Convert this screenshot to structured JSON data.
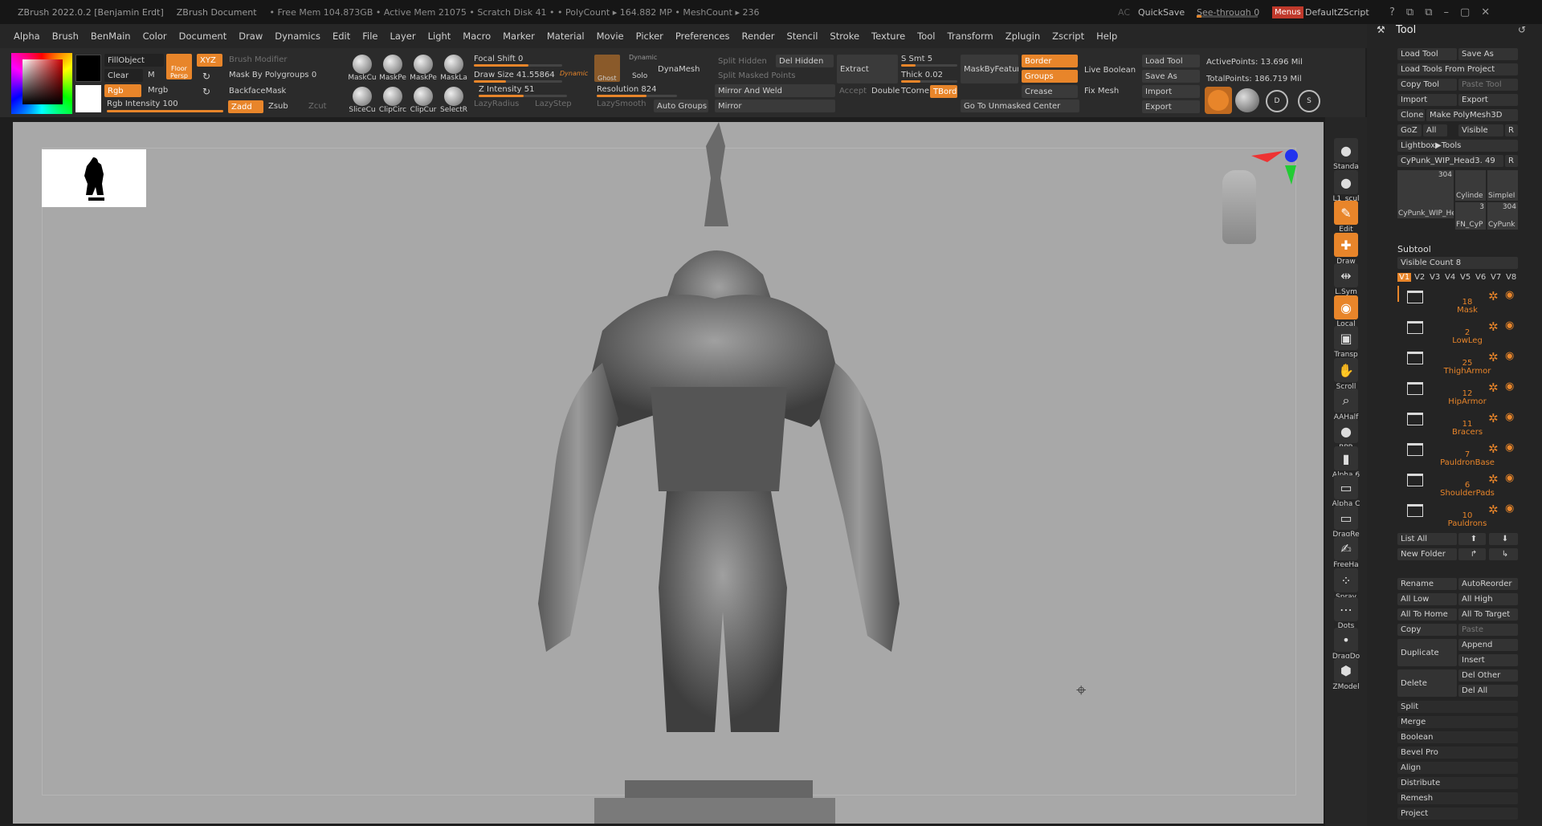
{
  "titlebar": {
    "app": "ZBrush 2022.0.2 [Benjamin Erdt]",
    "doc": "ZBrush Document",
    "stats": "• Free Mem 104.873GB • Active Mem 21075 • Scratch Disk 41 • • PolyCount ▸ 164.882 MP • MeshCount ▸ 236",
    "ac": "AC",
    "quicksave": "QuickSave",
    "seethrough": "See-through  0",
    "menus": "Menus",
    "script": "DefaultZScript"
  },
  "menu": [
    "Alpha",
    "Brush",
    "BenMain",
    "Color",
    "Document",
    "Draw",
    "Dynamics",
    "Edit",
    "File",
    "Layer",
    "Light",
    "Macro",
    "Marker",
    "Material",
    "Movie",
    "Picker",
    "Preferences",
    "Render",
    "Stencil",
    "Stroke",
    "Texture",
    "Tool",
    "Transform",
    "Zplugin",
    "Zscript",
    "Help"
  ],
  "shelf": {
    "fillobject": "FillObject",
    "clear": "Clear",
    "m": "M",
    "rgb": "Rgb",
    "mrgb": "Mrgb",
    "rgb_intensity": "Rgb Intensity 100",
    "persp": "Persp",
    "floor": "Floor",
    "xyz": "XYZ",
    "brush_modifier": "Brush Modifier",
    "mask_by_poly": "Mask By Polygroups 0",
    "backface": "BackfaceMask",
    "zadd": "Zadd",
    "zsub": "Zsub",
    "zcut": "Zcut",
    "brushes_top": [
      "MaskCu",
      "MaskPe",
      "MaskPe",
      "MaskLa"
    ],
    "brushes_bot": [
      "SliceCu",
      "ClipCirc",
      "ClipCur",
      "SelectR"
    ],
    "focal": "Focal Shift 0",
    "drawsize": "Draw Size 41.55864",
    "dynamic": "Dynamic",
    "zint": "Z Intensity 51",
    "lazyradius": "LazyRadius",
    "lazystep": "LazyStep",
    "lazysmooth": "LazySmooth",
    "ghost": "Ghost",
    "solo": "Solo",
    "dynamic2": "Dynamic",
    "dynamesh": "DynaMesh",
    "resolution": "Resolution 824",
    "autogroups": "Auto Groups",
    "splithidden": "Split Hidden",
    "delhidden": "Del Hidden",
    "splitmasked": "Split Masked Points",
    "mirrorweld": "Mirror And Weld",
    "mirror": "Mirror",
    "extract": "Extract",
    "accept": "Accept",
    "double": "Double",
    "ssmt": "S Smt 5",
    "thick": "Thick 0.02",
    "tcorne": "TCorne",
    "tborde": "TBorde",
    "maskbyfeat": "MaskByFeatur",
    "border": "Border",
    "groups": "Groups",
    "crease": "Crease",
    "gotounmasked": "Go To Unmasked Center",
    "liveboolean": "Live Boolean",
    "fixmesh": "Fix Mesh",
    "loadtool": "Load Tool",
    "saveas": "Save As",
    "import": "Import",
    "export": "Export",
    "activepoints": "ActivePoints: 13.696 Mil",
    "totalpoints": "TotalPoints: 186.719 Mil"
  },
  "rshelf": [
    "Standa",
    "L1_scul",
    "Edit",
    "Draw",
    "L.Sym",
    "Local",
    "Transp",
    "Scroll",
    "AAHalf",
    "BPR",
    "Alpha 6",
    "Alpha C",
    "DragRe",
    "FreeHa",
    "Spray",
    "Dots",
    "DragDo",
    "ZModel"
  ],
  "tool": {
    "title": "Tool",
    "load": "Load Tool",
    "saveas": "Save As",
    "loadproj": "Load Tools From Project",
    "copy": "Copy Tool",
    "paste": "Paste Tool",
    "import": "Import",
    "export": "Export",
    "clone": "Clone",
    "makepoly": "Make PolyMesh3D",
    "goz": "GoZ",
    "all": "All",
    "visible": "Visible",
    "r": "R",
    "lightbox": "Lightbox▶Tools",
    "current": "CyPunk_WIP_Head3. 49",
    "r2": "R",
    "thumbs": [
      {
        "label": "CyPunk_WIP_He",
        "n": "304"
      },
      {
        "label": "Cylinde",
        "n": ""
      },
      {
        "label": "SimpleI",
        "n": ""
      },
      {
        "label": "FN_CyP",
        "n": "3"
      },
      {
        "label": "CyPunk",
        "n": "304"
      }
    ]
  },
  "subtool": {
    "title": "Subtool",
    "visible": "Visible Count 8",
    "versions": [
      "V1",
      "V2",
      "V3",
      "V4",
      "V5",
      "V6",
      "V7",
      "V8"
    ],
    "folders": [
      {
        "n": "18",
        "name": "Mask"
      },
      {
        "n": "2",
        "name": "LowLeg"
      },
      {
        "n": "25",
        "name": "ThighArmor"
      },
      {
        "n": "12",
        "name": "HipArmor"
      },
      {
        "n": "11",
        "name": "Bracers"
      },
      {
        "n": "7",
        "name": "PauldronBase"
      },
      {
        "n": "6",
        "name": "ShoulderPads"
      },
      {
        "n": "10",
        "name": "Pauldrons"
      }
    ],
    "listall": "List All",
    "newfolder": "New Folder",
    "rename": "Rename",
    "autoreorder": "AutoReorder",
    "alllow": "All Low",
    "allhigh": "All High",
    "allhome": "All To Home",
    "alltarget": "All To Target",
    "copy": "Copy",
    "paste": "Paste",
    "duplicate": "Duplicate",
    "append": "Append",
    "insert": "Insert",
    "delete": "Delete",
    "delother": "Del Other",
    "delall": "Del All"
  },
  "actions": [
    "Split",
    "Merge",
    "Boolean",
    "Bevel Pro",
    "Align",
    "Distribute",
    "Remesh",
    "Project"
  ],
  "colors": {
    "accent": "#e8852a",
    "viewport": "#a8a8a8"
  }
}
